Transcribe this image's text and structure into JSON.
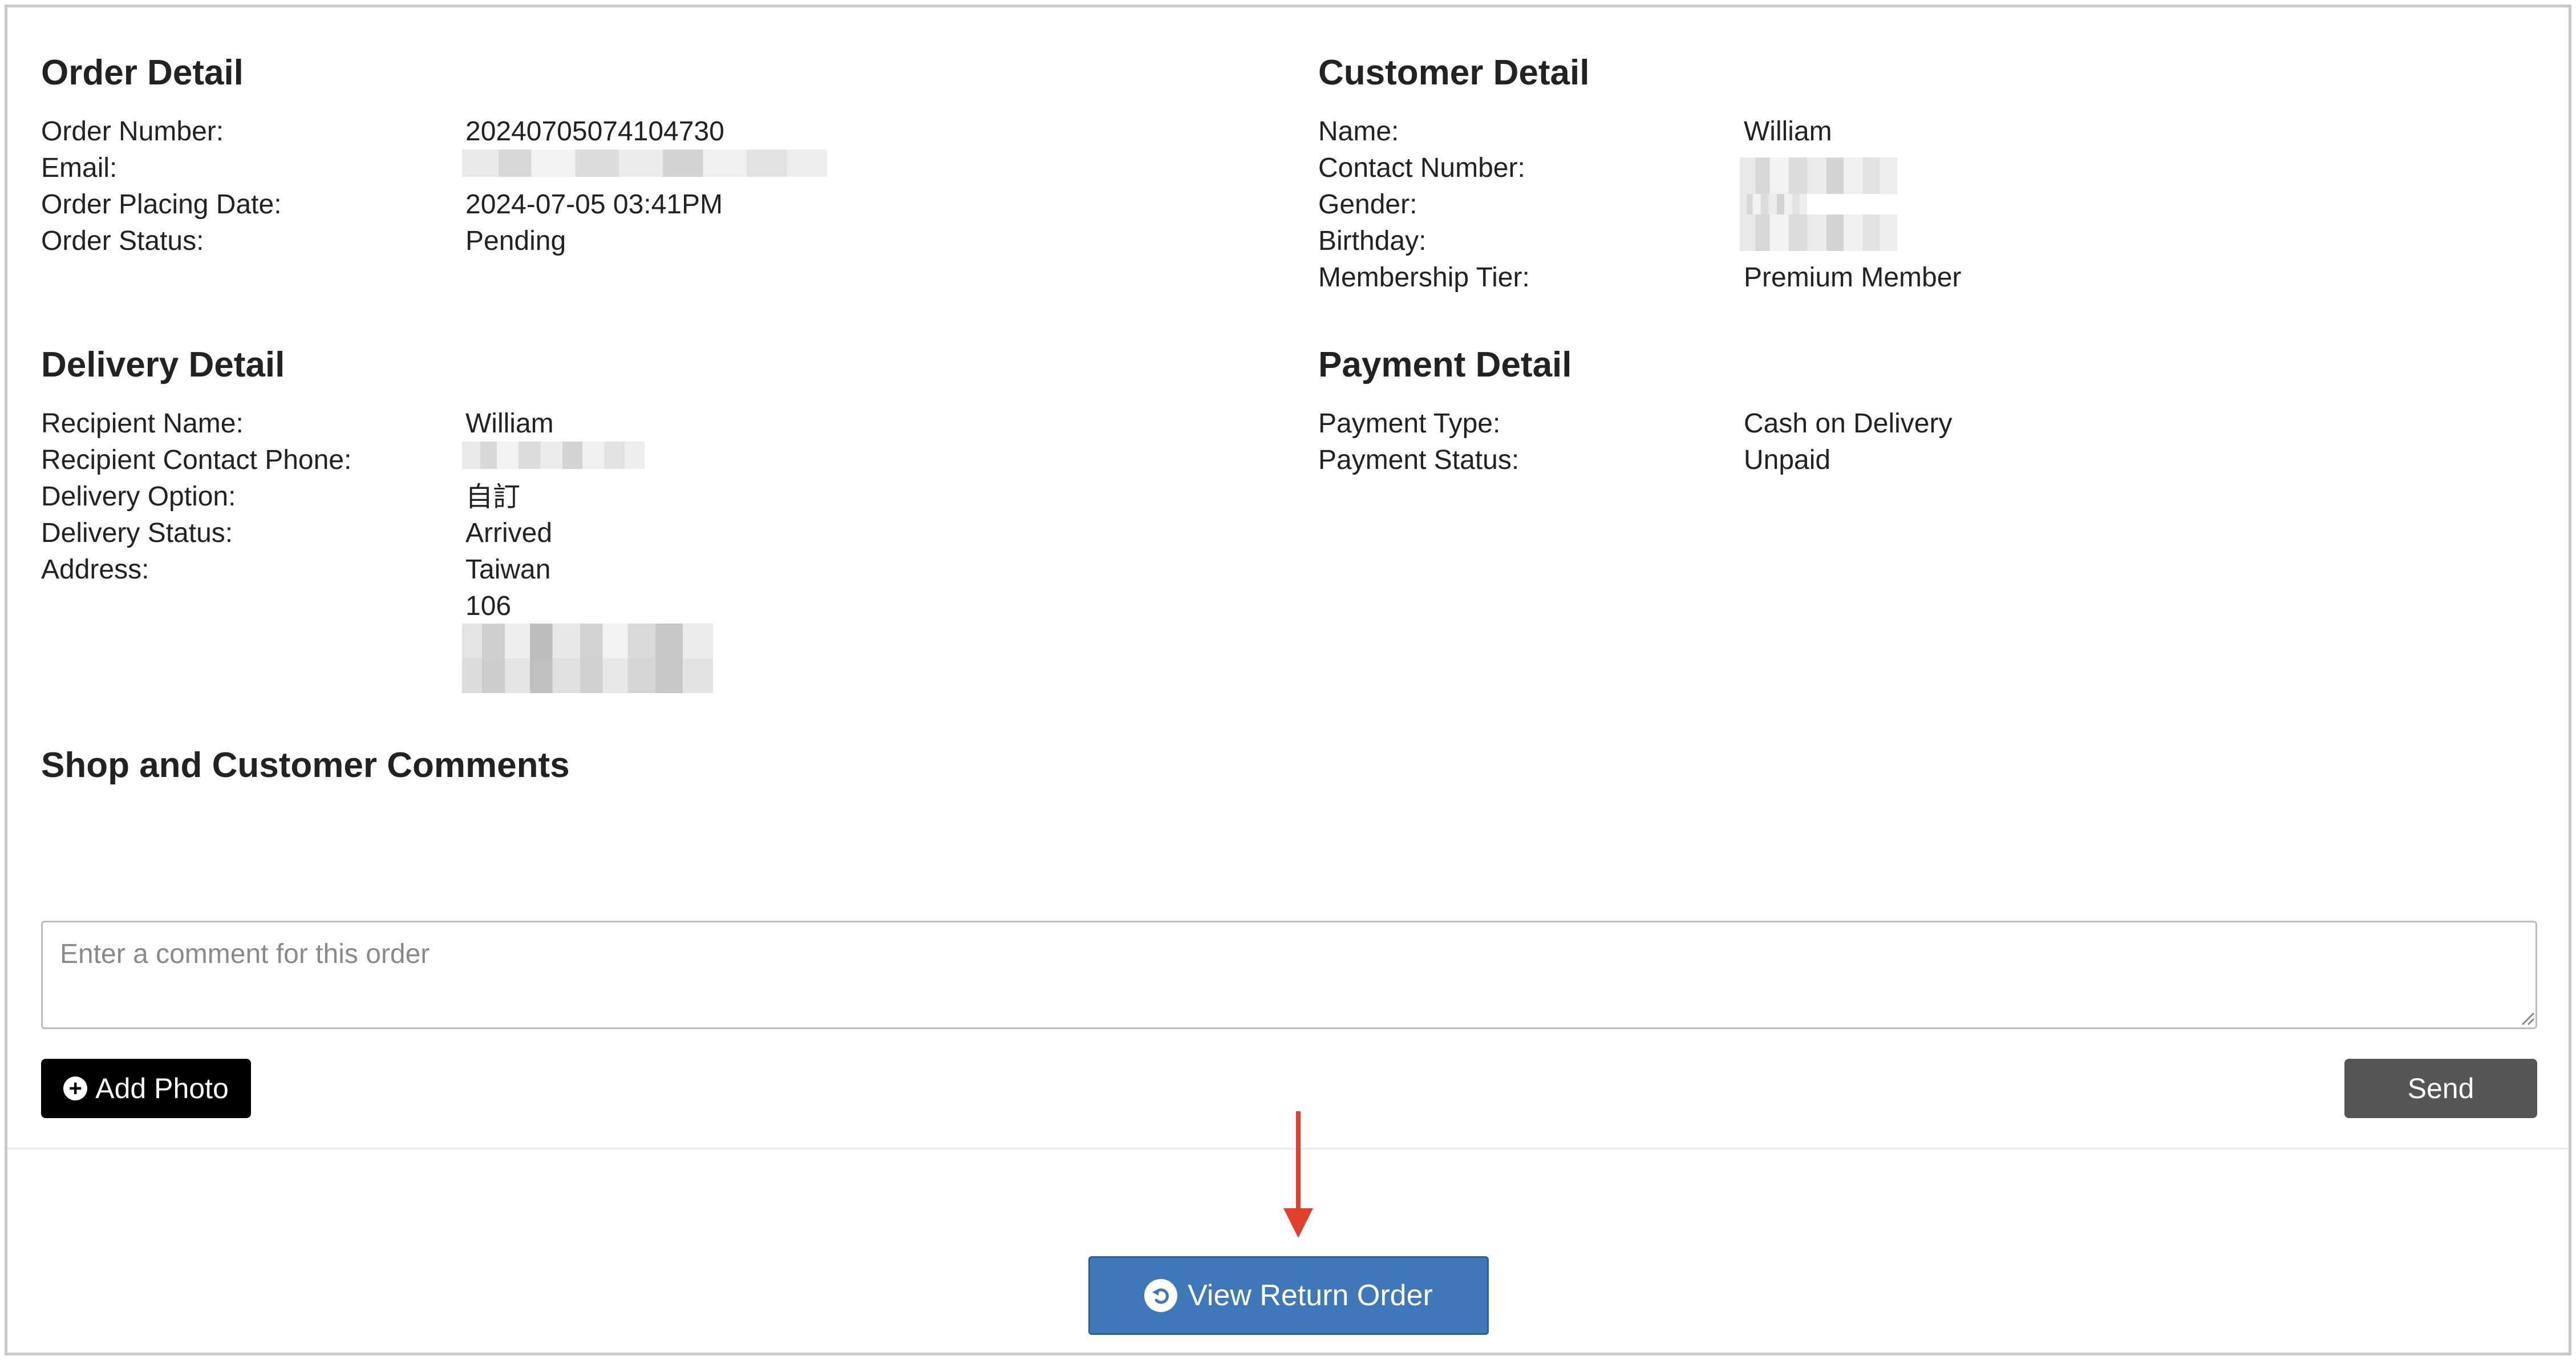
{
  "order_detail": {
    "title": "Order Detail",
    "rows": [
      {
        "label": "Order Number:",
        "value": "20240705074104730"
      },
      {
        "label": "Email:",
        "value": ""
      },
      {
        "label": "Order Placing Date:",
        "value": "2024-07-05 03:41PM"
      },
      {
        "label": "Order Status:",
        "value": "Pending"
      }
    ]
  },
  "customer_detail": {
    "title": "Customer Detail",
    "rows": [
      {
        "label": "Name:",
        "value": "William"
      },
      {
        "label": "Contact Number:",
        "value": ""
      },
      {
        "label": "Gender:",
        "value": ""
      },
      {
        "label": "Birthday:",
        "value": ""
      },
      {
        "label": "Membership Tier:",
        "value": "Premium Member"
      }
    ]
  },
  "delivery_detail": {
    "title": "Delivery Detail",
    "rows": [
      {
        "label": "Recipient Name:",
        "value": "William"
      },
      {
        "label": "Recipient Contact Phone:",
        "value": ""
      },
      {
        "label": "Delivery Option:",
        "value": "自訂"
      },
      {
        "label": "Delivery Status:",
        "value": "Arrived"
      },
      {
        "label": "Address:",
        "value": "Taiwan"
      }
    ],
    "address_line2": "106"
  },
  "payment_detail": {
    "title": "Payment Detail",
    "rows": [
      {
        "label": "Payment Type:",
        "value": "Cash on Delivery"
      },
      {
        "label": "Payment Status:",
        "value": "Unpaid"
      }
    ]
  },
  "comments": {
    "title": "Shop and Customer Comments",
    "placeholder": "Enter a comment for this order",
    "add_photo_label": "Add Photo",
    "send_label": "Send"
  },
  "footer": {
    "view_return_label": "View Return Order"
  },
  "colors": {
    "primary_button": "#3f78b8",
    "send_button": "#555555",
    "arrow": "#e0402b"
  },
  "icons": {
    "add_photo": "plus-circle-icon",
    "view_return": "undo-circle-icon",
    "annotation": "arrow-down-icon"
  }
}
